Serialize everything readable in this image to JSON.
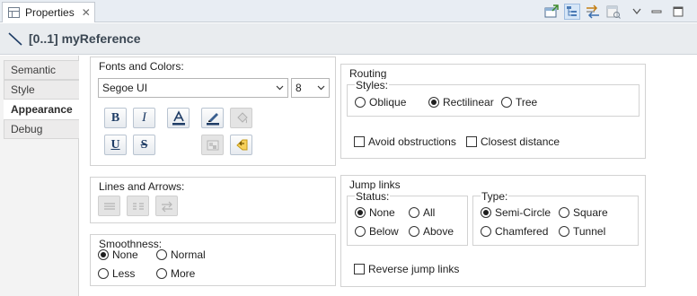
{
  "view_tab": {
    "label": "Properties"
  },
  "title": {
    "text": "[0..1] myReference"
  },
  "categories": [
    {
      "label": "Semantic",
      "selected": false
    },
    {
      "label": "Style",
      "selected": false
    },
    {
      "label": "Appearance",
      "selected": true
    },
    {
      "label": "Debug",
      "selected": false
    }
  ],
  "fonts_colors": {
    "title": "Fonts and Colors:",
    "font_name": "Segoe UI",
    "font_size": "8",
    "bold_label": "B",
    "italic_label": "I",
    "underline_label": "U",
    "strike_label": "S"
  },
  "lines_arrows": {
    "title": "Lines and Arrows:"
  },
  "smoothness": {
    "title": "Smoothness:",
    "options": {
      "none": "None",
      "normal": "Normal",
      "less": "Less",
      "more": "More"
    },
    "selected": "None"
  },
  "routing": {
    "title": "Routing",
    "styles_title": "Styles:",
    "options": {
      "oblique": "Oblique",
      "rectilinear": "Rectilinear",
      "tree": "Tree"
    },
    "selected": "Rectilinear",
    "avoid_obstructions": "Avoid obstructions",
    "closest_distance": "Closest distance"
  },
  "jump_links": {
    "title": "Jump links",
    "status_title": "Status:",
    "status_options": {
      "none": "None",
      "all": "All",
      "below": "Below",
      "above": "Above"
    },
    "status_selected": "None",
    "type_title": "Type:",
    "type_options": {
      "semi_circle": "Semi-Circle",
      "square": "Square",
      "chamfered": "Chamfered",
      "tunnel": "Tunnel"
    },
    "type_selected": "Semi-Circle",
    "reverse": "Reverse jump links"
  },
  "colors": {
    "accent": "#d6e6f7",
    "title_text": "#3b4753"
  }
}
